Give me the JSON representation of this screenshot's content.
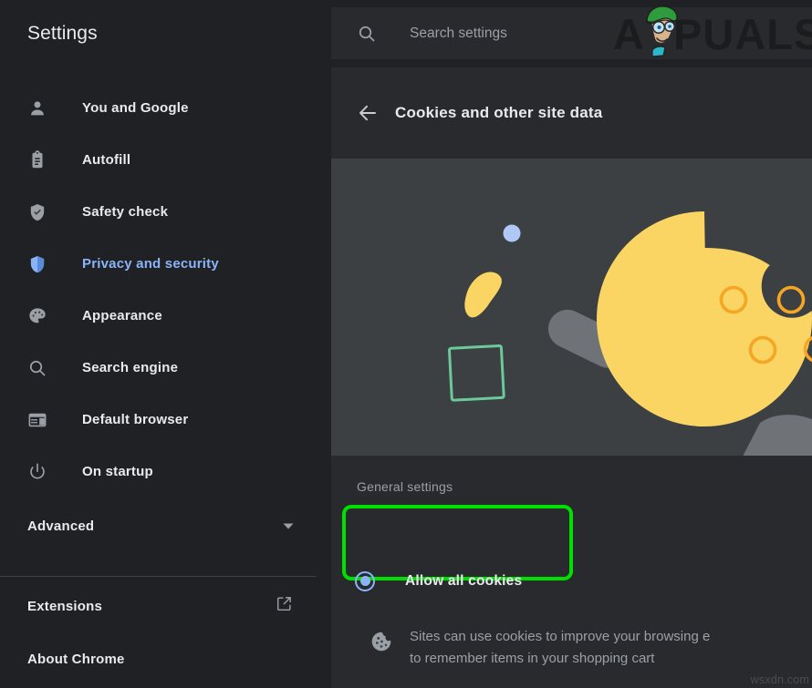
{
  "sidebar": {
    "title": "Settings",
    "items": [
      {
        "label": "You and Google",
        "icon": "person-icon",
        "active": false
      },
      {
        "label": "Autofill",
        "icon": "clipboard-icon",
        "active": false
      },
      {
        "label": "Safety check",
        "icon": "shield-check-icon",
        "active": false
      },
      {
        "label": "Privacy and security",
        "icon": "shield-icon",
        "active": true
      },
      {
        "label": "Appearance",
        "icon": "palette-icon",
        "active": false
      },
      {
        "label": "Search engine",
        "icon": "magnifier-icon",
        "active": false
      },
      {
        "label": "Default browser",
        "icon": "browser-window-icon",
        "active": false
      },
      {
        "label": "On startup",
        "icon": "power-icon",
        "active": false
      }
    ],
    "advanced": {
      "label": "Advanced",
      "icon": "chevron-down-icon"
    },
    "footer": [
      {
        "label": "Extensions",
        "icon": "external-link-icon"
      },
      {
        "label": "About Chrome",
        "icon": ""
      }
    ]
  },
  "topbar": {
    "search_placeholder": "Search settings",
    "search_value": "",
    "search_icon": "search-icon",
    "logo_text": "APPUALS"
  },
  "main": {
    "back_icon": "back-arrow-icon",
    "page_title": "Cookies and other site data",
    "section_label": "General settings",
    "radio": {
      "label": "Allow all cookies",
      "selected": true,
      "description": "Sites can use cookies to improve your browsing e\nto remember items in your shopping cart",
      "description_icon": "cookie-icon"
    }
  },
  "watermark": "wsxdn.com",
  "colors": {
    "page_bg": "#202124",
    "panel_bg": "#292a2d",
    "hero_bg": "#3c4043",
    "accent_blue": "#8ab4f8",
    "text_primary": "#e8eaed",
    "text_secondary": "#9aa0a6",
    "highlight_green": "#00e000",
    "cookie_yellow": "#fbd563",
    "cookie_chip_orange": "#f5a623",
    "crumb_gray": "#6f7276",
    "square_green": "#6cc99a"
  }
}
